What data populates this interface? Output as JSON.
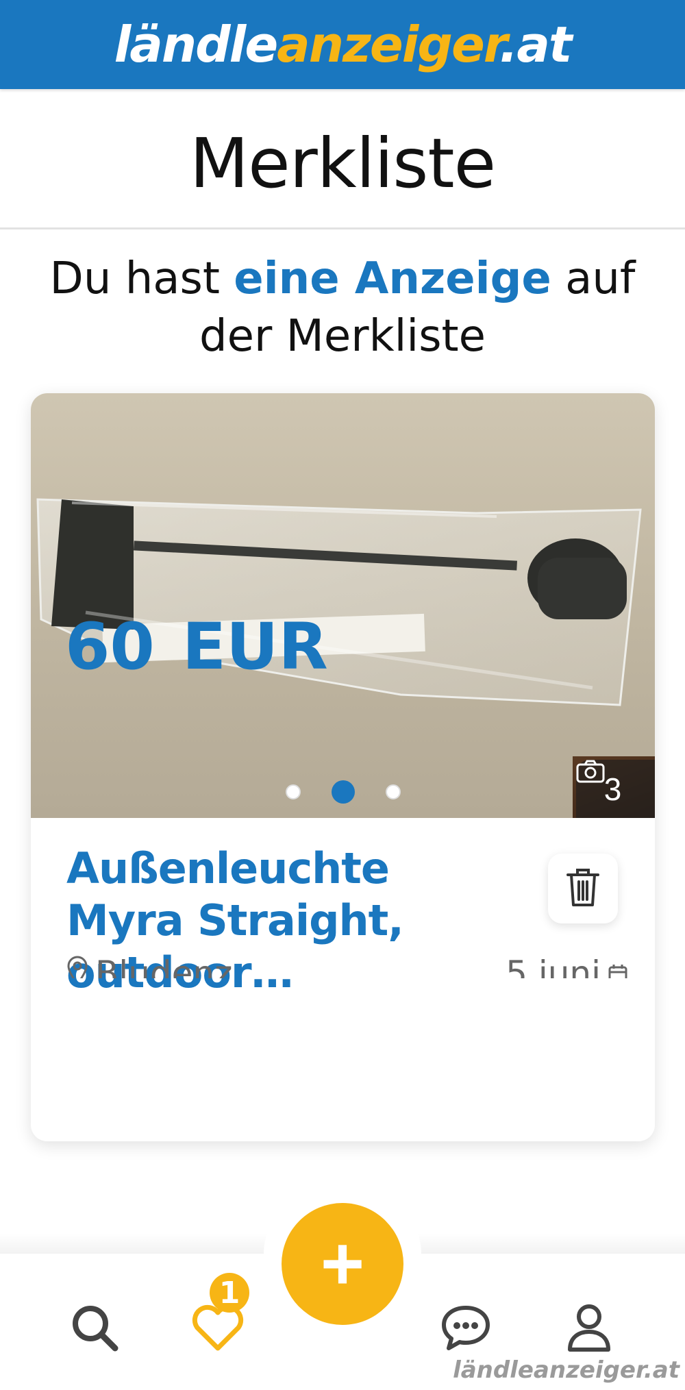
{
  "header": {
    "logo_part1": "ländle",
    "logo_part2": "anzeiger",
    "logo_part3": ".at"
  },
  "page_title": "Merkliste",
  "summary": {
    "prefix": "Du hast ",
    "highlight": "eine Anzeige",
    "suffix": " auf der Merkliste"
  },
  "listing": {
    "title": "Außenleuchte Myra Straight, outdoor…",
    "photo_count": "3",
    "photo_total": 3,
    "photo_active_index": 1,
    "location": "Bludenz",
    "date": "5 juni",
    "price_amount": "60",
    "price_currency": "EUR",
    "delete_icon": "trash-icon",
    "camera_icon": "camera-icon",
    "location_icon": "location-pin-icon",
    "date_icon": "calendar-icon"
  },
  "bottom_nav": {
    "items": [
      {
        "name": "search",
        "icon": "search-icon"
      },
      {
        "name": "favorites",
        "icon": "heart-icon",
        "badge": "1"
      },
      {
        "name": "add",
        "icon": "plus-icon",
        "label": "+"
      },
      {
        "name": "messages",
        "icon": "chat-icon"
      },
      {
        "name": "profile",
        "icon": "user-icon"
      }
    ]
  },
  "watermark": "ländleanzeiger.at",
  "colors": {
    "brand_blue": "#1a77bf",
    "accent_yellow": "#f7b515",
    "text": "#111111",
    "muted": "#666666"
  }
}
